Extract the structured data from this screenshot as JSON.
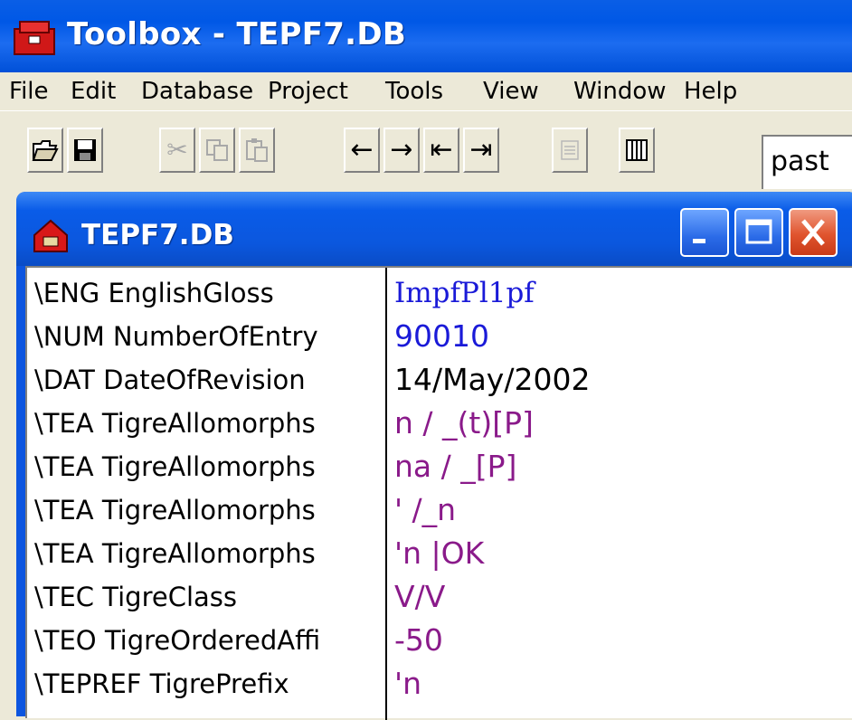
{
  "app": {
    "title": "Toolbox - TEPF7.DB"
  },
  "menu": [
    {
      "label": "File"
    },
    {
      "label": "Edit"
    },
    {
      "label": "Database"
    },
    {
      "label": "Project"
    },
    {
      "label": "Tools"
    },
    {
      "label": "View"
    },
    {
      "label": "Window"
    },
    {
      "label": "Help"
    }
  ],
  "toolbar": {
    "buttons": [
      {
        "icon": "open-folder-icon",
        "enabled": true
      },
      {
        "icon": "save-disk-icon",
        "enabled": true
      },
      {
        "icon": "cut-scissors-icon",
        "enabled": false
      },
      {
        "icon": "copy-icon",
        "enabled": false
      },
      {
        "icon": "paste-icon",
        "enabled": false
      },
      {
        "icon": "arrow-left-icon",
        "glyph": "←",
        "enabled": true
      },
      {
        "icon": "arrow-right-icon",
        "glyph": "→",
        "enabled": true
      },
      {
        "icon": "arrow-first-icon",
        "glyph": "⇤",
        "enabled": true
      },
      {
        "icon": "arrow-last-icon",
        "glyph": "⇥",
        "enabled": true
      },
      {
        "icon": "list-icon",
        "enabled": false
      },
      {
        "icon": "browse-grid-icon",
        "enabled": true
      }
    ],
    "combo_value": "past"
  },
  "child_window": {
    "title": "TEPF7.DB"
  },
  "colors": {
    "value_blue": "#1a1ad8",
    "value_black": "#000000",
    "value_purple": "#8a1a8a"
  },
  "fields": [
    {
      "marker": "\\ENG EnglishGloss",
      "value": "ImpfPl1pf",
      "color": "#1a1ad8",
      "serif": true
    },
    {
      "marker": "\\NUM NumberOfEntry",
      "value": "90010",
      "color": "#1a1ad8"
    },
    {
      "marker": "\\DAT DateOfRevision",
      "value": "14/May/2002",
      "color": "#000000"
    },
    {
      "marker": "\\TEA TigreAllomorphs",
      "value": "n  / _(t)[P]",
      "color": "#8a1a8a"
    },
    {
      "marker": "\\TEA TigreAllomorphs",
      "value": "na / _[P]",
      "color": "#8a1a8a"
    },
    {
      "marker": "\\TEA TigreAllomorphs",
      "value": "' /_n",
      "color": "#8a1a8a"
    },
    {
      "marker": "\\TEA TigreAllomorphs",
      "value": "'n |OK",
      "color": "#8a1a8a"
    },
    {
      "marker": "\\TEC TigreClass",
      "value": "V/V",
      "color": "#8a1a8a"
    },
    {
      "marker": "\\TEO TigreOrderedAffi",
      "value": "-50",
      "color": "#8a1a8a"
    },
    {
      "marker": "\\TEPREF TigrePrefix",
      "value": "'n",
      "color": "#8a1a8a"
    }
  ]
}
